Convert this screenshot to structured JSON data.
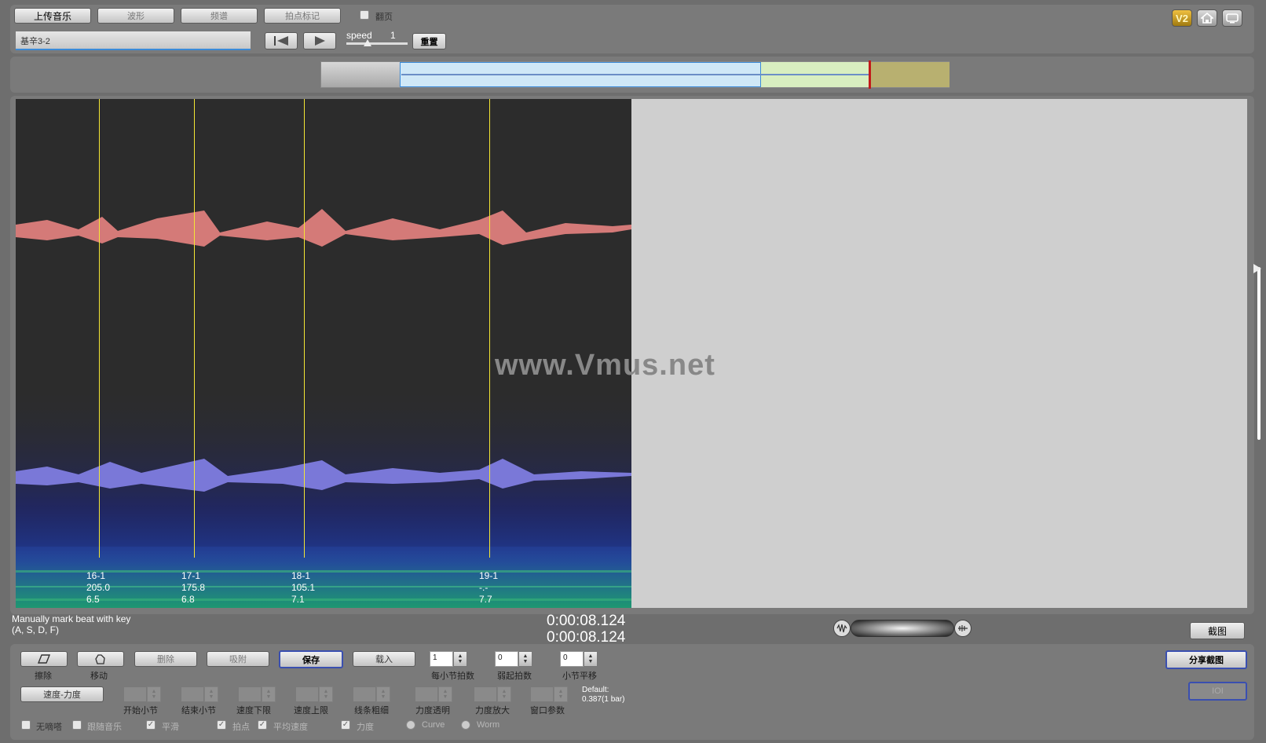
{
  "toolbar": {
    "upload_music": "上传音乐",
    "waveform": "波形",
    "spectrum": "频谱",
    "beat_mark": "拍点标记",
    "page_flip_label": "翻页",
    "track_name": "基辛3-2",
    "speed_label": "speed",
    "speed_value": "1",
    "reset": "重置",
    "v2_label": "V2"
  },
  "icons": {
    "home": "home-icon",
    "screen": "screen-icon",
    "rewind": "skip-back-icon",
    "play": "play-icon",
    "slider": "speed-slider-thumb-icon"
  },
  "watermark": "www.Vmus.net",
  "beats": [
    {
      "bar": "16-1",
      "tempo": "205.0",
      "dynamic": "6.5"
    },
    {
      "bar": "17-1",
      "tempo": "175.8",
      "dynamic": "6.8"
    },
    {
      "bar": "18-1",
      "tempo": "105.1",
      "dynamic": "7.1"
    },
    {
      "bar": "19-1",
      "tempo": "-.-",
      "dynamic": "7.7"
    }
  ],
  "hint": {
    "line1": "Manually mark beat with key",
    "line2": "(A, S, D, F)"
  },
  "time": {
    "current": "0:00:08.124",
    "total": "0:00:08.124"
  },
  "screenshot_button": "截图",
  "controls": {
    "erase": "擦除",
    "move": "移动",
    "delete": "删除",
    "snap": "吸附",
    "save": "保存",
    "load": "载入",
    "beats_per_bar_value": "1",
    "beats_per_bar_label": "每小节拍数",
    "pickup_value": "0",
    "pickup_label": "弱起拍数",
    "bar_shift_value": "0",
    "bar_shift_label": "小节平移",
    "share_screenshot": "分享截图",
    "ior": "IOI",
    "tempo_dynamic": "速度-力度",
    "start_bar": "开始小节",
    "end_bar": "结束小节",
    "tempo_low": "速度下限",
    "tempo_high": "速度上限",
    "line_width": "线条粗细",
    "dynamic_opacity": "力度透明",
    "dynamic_scale": "力度放大",
    "window_param": "窗口参数",
    "default_line1": "Default:",
    "default_line2": "0.387(1 bar)",
    "no_noise": "无嘀嗒",
    "follow_music": "跟随音乐",
    "smooth": "平滑",
    "beat_point": "拍点",
    "avg_tempo": "平均速度",
    "dynamic": "力度",
    "curve": "Curve",
    "worm": "Worm"
  },
  "colors": {
    "waveform_top": "#d47a78",
    "waveform_bottom": "#7a78d8",
    "beat_line": "#f4e634",
    "overview_blue": "#cfe8f7",
    "overview_green": "#d8eec0",
    "overview_olive": "#b8b070"
  }
}
